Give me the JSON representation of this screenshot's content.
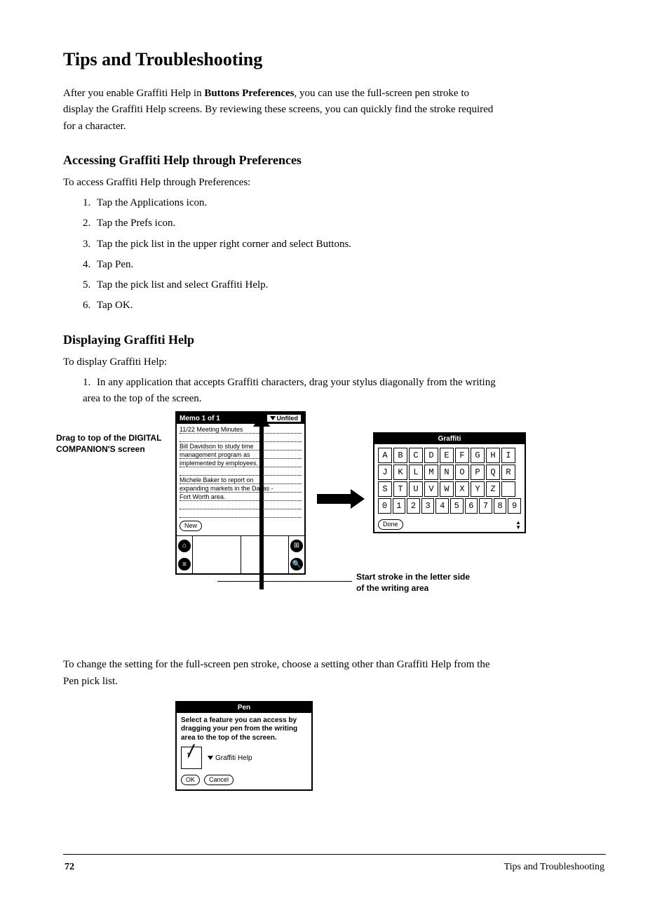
{
  "heading": "Tips and Troubleshooting",
  "intro_1a": "After you enable Graffiti Help in ",
  "intro_1b_bold": "Buttons Preferences",
  "intro_1c": ", you can use the full-screen pen stroke to display the Graffiti Help screens. By reviewing these screens, you can quickly find the stroke required for a character.",
  "section_accessing": "Accessing Graffiti Help through Preferences",
  "to_access": "To access Graffiti Help through Preferences:",
  "steps_a": [
    "Tap the Applications icon.",
    "Tap the Prefs icon.",
    "Tap the pick list in the upper right corner and select Buttons.",
    "Tap Pen.",
    "Tap the pick list and select Graffiti Help.",
    "Tap OK."
  ],
  "section_display": "Displaying Graffiti Help",
  "to_display": "To display Graffiti Help:",
  "step_display_1": "In any application that accepts Graffiti characters, drag your stylus diagonally from the writing area to the top of the screen.",
  "callout_arrow": "Drag to top of the DIGITAL COMPANION'S screen",
  "callout_start": "Start stroke in the letter side of the writing area",
  "memo": {
    "title": "Memo 1 of 1",
    "category": "Unfiled",
    "lines": [
      "11/22 Meeting Minutes",
      "",
      "Bill Davidson to study time",
      "management program as",
      "implemented by employees.",
      "",
      "Michele Baker to report on",
      "expanding markets in the Dallas -",
      "Fort Worth area."
    ],
    "new_btn": "New"
  },
  "graffiti": {
    "title": "Graffiti",
    "rows": [
      [
        "A",
        "B",
        "C",
        "D",
        "E",
        "F",
        "G",
        "H",
        "I"
      ],
      [
        "J",
        "K",
        "L",
        "M",
        "N",
        "O",
        "P",
        "Q",
        "R"
      ],
      [
        "S",
        "T",
        "U",
        "V",
        "W",
        "X",
        "Y",
        "Z",
        " "
      ],
      [
        "0",
        "1",
        "2",
        "3",
        "4",
        "5",
        "6",
        "7",
        "8",
        "9"
      ]
    ],
    "done": "Done"
  },
  "intro_2": "To change the setting for the full-screen pen stroke, choose a setting other than Graffiti Help from the Pen pick list.",
  "pen": {
    "title": "Pen",
    "text": "Select a feature you can access by dragging your pen from the writing area to the top of the screen.",
    "selection": "Graffiti Help",
    "ok": "OK",
    "cancel": "Cancel"
  },
  "footer": {
    "page": "72",
    "title": "Tips and Troubleshooting"
  }
}
